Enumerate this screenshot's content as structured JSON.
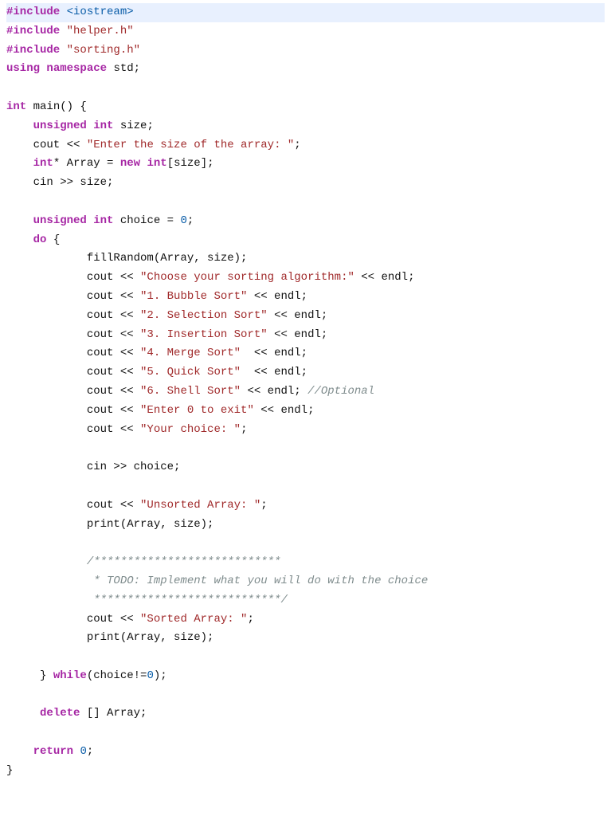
{
  "code": {
    "l1a": "#include",
    "l1b": "<iostream>",
    "l2a": "#include",
    "l2b": "\"helper.h\"",
    "l3a": "#include",
    "l3b": "\"sorting.h\"",
    "l4a": "using",
    "l4b": "namespace",
    "l4c": " std;",
    "l5": "",
    "l6a": "int",
    "l6b": " main() {",
    "l7a": "    ",
    "l7b": "unsigned",
    "l7c": " ",
    "l7d": "int",
    "l7e": " size;",
    "l8a": "    cout << ",
    "l8b": "\"Enter the size of the array: \"",
    "l8c": ";",
    "l9a": "    ",
    "l9b": "int",
    "l9c": "* Array = ",
    "l9d": "new",
    "l9e": " ",
    "l9f": "int",
    "l9g": "[size];",
    "l10": "    cin >> size;",
    "l11": "",
    "l12a": "    ",
    "l12b": "unsigned",
    "l12c": " ",
    "l12d": "int",
    "l12e": " choice = ",
    "l12f": "0",
    "l12g": ";",
    "l13a": "    ",
    "l13b": "do",
    "l13c": " {",
    "l14": "            fillRandom(Array, size);",
    "l15a": "            cout << ",
    "l15b": "\"Choose your sorting algorithm:\"",
    "l15c": " << endl;",
    "l16a": "            cout << ",
    "l16b": "\"1. Bubble Sort\"",
    "l16c": " << endl;",
    "l17a": "            cout << ",
    "l17b": "\"2. Selection Sort\"",
    "l17c": " << endl;",
    "l18a": "            cout << ",
    "l18b": "\"3. Insertion Sort\"",
    "l18c": " << endl;",
    "l19a": "            cout << ",
    "l19b": "\"4. Merge Sort\"",
    "l19c": "  << endl;",
    "l20a": "            cout << ",
    "l20b": "\"5. Quick Sort\"",
    "l20c": "  << endl;",
    "l21a": "            cout << ",
    "l21b": "\"6. Shell Sort\"",
    "l21c": " << endl; ",
    "l21d": "//Optional",
    "l22a": "            cout << ",
    "l22b": "\"Enter 0 to exit\"",
    "l22c": " << endl;",
    "l23a": "            cout << ",
    "l23b": "\"Your choice: \"",
    "l23c": ";",
    "l24": "",
    "l25": "            cin >> choice;",
    "l26": "",
    "l27a": "            cout << ",
    "l27b": "\"Unsorted Array: \"",
    "l27c": ";",
    "l28": "            print(Array, size);",
    "l29": "",
    "l30": "            /****************************",
    "l31": "             * TODO: Implement what you will do with the choice",
    "l32": "             ****************************/",
    "l33a": "            cout << ",
    "l33b": "\"Sorted Array: \"",
    "l33c": ";",
    "l34": "            print(Array, size);",
    "l35": "",
    "l36a": "     } ",
    "l36b": "while",
    "l36c": "(choice!=",
    "l36d": "0",
    "l36e": ");",
    "l37": "",
    "l38a": "     ",
    "l38b": "delete",
    "l38c": " [] Array;",
    "l39": "",
    "l40a": "    ",
    "l40b": "return",
    "l40c": " ",
    "l40d": "0",
    "l40e": ";",
    "l41": "}"
  }
}
